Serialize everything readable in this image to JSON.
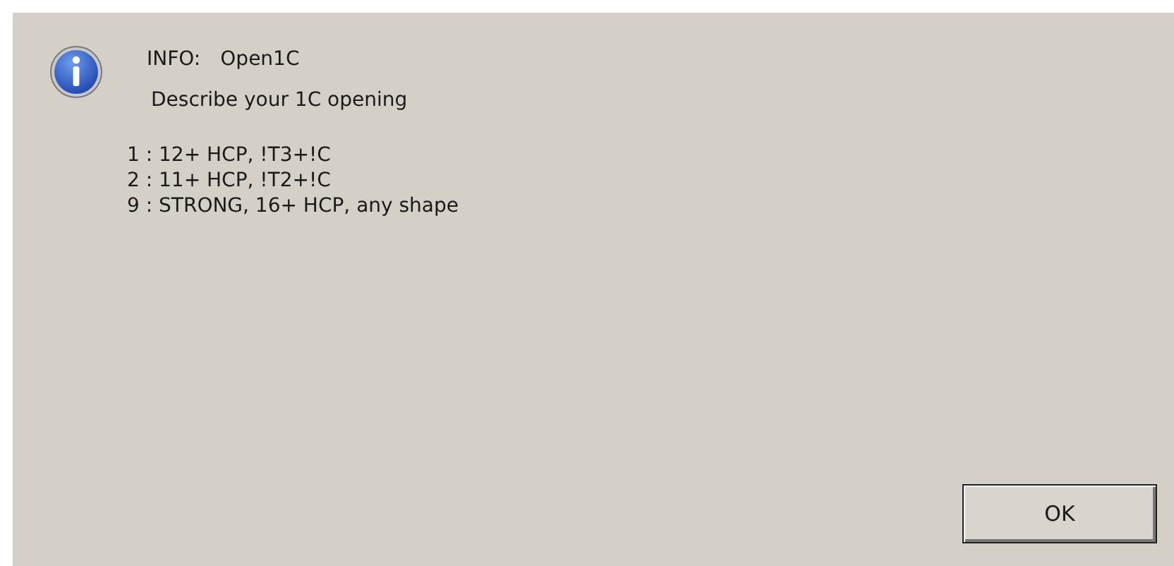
{
  "dialog": {
    "label": "INFO:",
    "title": "Open1C",
    "prompt": "Describe your 1C opening",
    "options": [
      "1 : 12+ HCP, !T3+!C",
      "2 : 11+ HCP, !T2+!C",
      "9 : STRONG, 16+ HCP, any shape"
    ],
    "buttons": [
      "OK"
    ]
  }
}
